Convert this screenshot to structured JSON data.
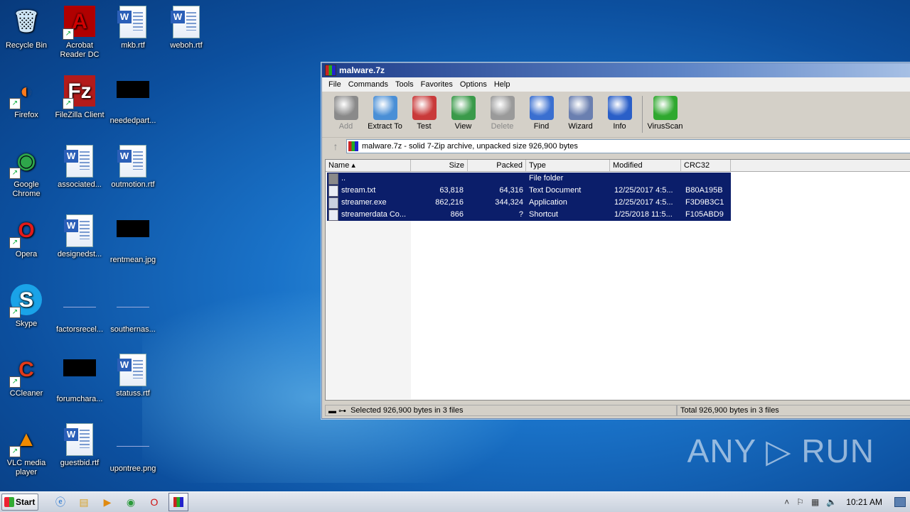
{
  "desktop": {
    "icons": [
      {
        "label": "Recycle Bin",
        "icon": "recycle-bin-icon"
      },
      {
        "label": "Acrobat Reader DC",
        "icon": "acrobat-icon"
      },
      {
        "label": "mkb.rtf",
        "icon": "word-doc-icon"
      },
      {
        "label": "weboh.rtf",
        "icon": "word-doc-icon"
      },
      {
        "label": "Firefox",
        "icon": "firefox-icon"
      },
      {
        "label": "FileZilla Client",
        "icon": "filezilla-icon"
      },
      {
        "label": "neededpart...",
        "icon": "black-file-icon"
      },
      {
        "label": "Google Chrome",
        "icon": "chrome-icon"
      },
      {
        "label": "associated...",
        "icon": "word-doc-icon"
      },
      {
        "label": "outmotion.rtf",
        "icon": "word-doc-icon"
      },
      {
        "label": "Opera",
        "icon": "opera-icon"
      },
      {
        "label": "designedst...",
        "icon": "word-doc-icon"
      },
      {
        "label": "rentmean.jpg",
        "icon": "black-file-icon"
      },
      {
        "label": "Skype",
        "icon": "skype-icon"
      },
      {
        "label": "factorsrecel...",
        "icon": "blank-file-icon"
      },
      {
        "label": "southernas...",
        "icon": "blank-file-icon"
      },
      {
        "label": "CCleaner",
        "icon": "ccleaner-icon"
      },
      {
        "label": "forumchara...",
        "icon": "black-file-icon"
      },
      {
        "label": "statuss.rtf",
        "icon": "word-doc-icon"
      },
      {
        "label": "VLC media player",
        "icon": "vlc-icon"
      },
      {
        "label": "guestbid.rtf",
        "icon": "word-doc-icon"
      },
      {
        "label": "upontree.png",
        "icon": "blank-file-icon"
      }
    ],
    "watermark": "ANY ▷ RUN"
  },
  "window": {
    "title": "malware.7z",
    "menu": [
      "File",
      "Commands",
      "Tools",
      "Favorites",
      "Options",
      "Help"
    ],
    "toolbar": [
      {
        "label": "Add",
        "disabled": true,
        "color": "#8a8a8a"
      },
      {
        "label": "Extract To",
        "disabled": false,
        "color": "#4a8fd6"
      },
      {
        "label": "Test",
        "disabled": false,
        "color": "#c93a3a"
      },
      {
        "label": "View",
        "disabled": false,
        "color": "#3a9a4a"
      },
      {
        "label": "Delete",
        "disabled": true,
        "color": "#9a9a9a"
      },
      {
        "label": "Find",
        "disabled": false,
        "color": "#3a6fd0"
      },
      {
        "label": "Wizard",
        "disabled": false,
        "color": "#6a7fb0"
      },
      {
        "label": "Info",
        "disabled": false,
        "color": "#2a5fc8"
      },
      {
        "label": "VirusScan",
        "disabled": false,
        "color": "#2fa82f"
      }
    ],
    "address": "malware.7z - solid 7-Zip archive, unpacked size 926,900 bytes",
    "columns": [
      "Name",
      "Size",
      "Packed",
      "Type",
      "Modified",
      "CRC32"
    ],
    "rows": [
      {
        "name": "..",
        "size": "",
        "packed": "",
        "type": "File folder",
        "modified": "",
        "crc": ""
      },
      {
        "name": "stream.txt",
        "size": "63,818",
        "packed": "64,316",
        "type": "Text Document",
        "modified": "12/25/2017 4:5...",
        "crc": "B80A195B"
      },
      {
        "name": "streamer.exe",
        "size": "862,216",
        "packed": "344,324",
        "type": "Application",
        "modified": "12/25/2017 4:5...",
        "crc": "F3D9B3C1"
      },
      {
        "name": "streamerdata Co...",
        "size": "866",
        "packed": "?",
        "type": "Shortcut",
        "modified": "1/25/2018 11:5...",
        "crc": "F105ABD9"
      }
    ],
    "status_left": "Selected 926,900 bytes in 3 files",
    "status_right": "Total 926,900 bytes in 3 files"
  },
  "taskbar": {
    "start_label": "Start",
    "clock": "10:21 AM"
  }
}
